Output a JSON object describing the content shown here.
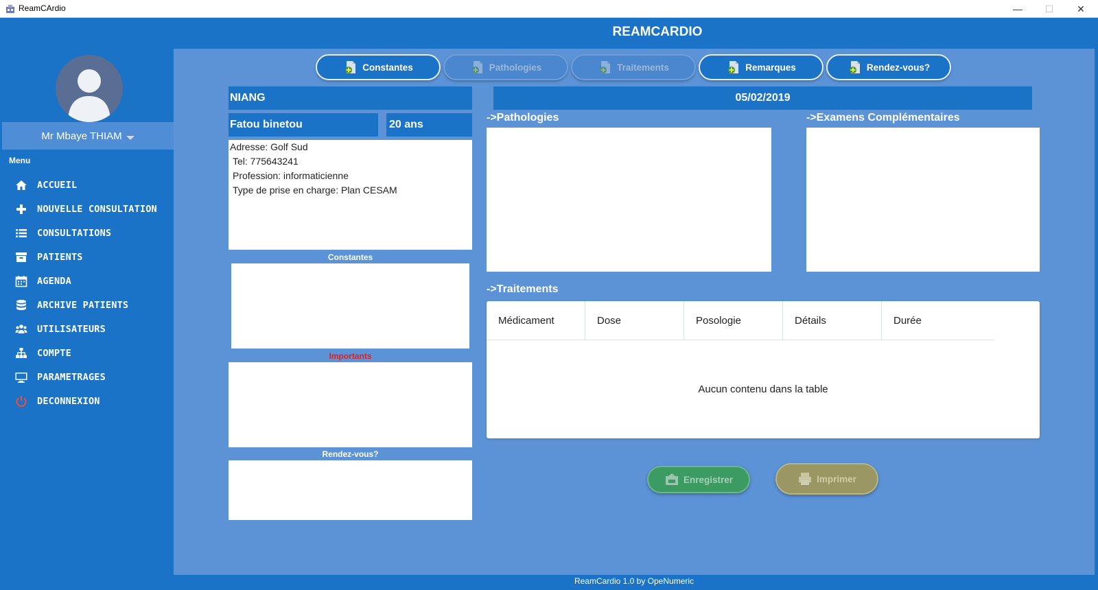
{
  "window": {
    "title": "ReamCArdio",
    "controls": {
      "minimize": "—",
      "maximize": "☐",
      "close": "✕"
    }
  },
  "header": {
    "title": "REAMCARDIO"
  },
  "sidebar": {
    "user_name": "Mr Mbaye THIAM",
    "menu_label": "Menu",
    "items": [
      {
        "label": "ACCUEIL",
        "icon": "home-icon"
      },
      {
        "label": "NOUVELLE CONSULTATION",
        "icon": "plus-icon"
      },
      {
        "label": "CONSULTATIONS",
        "icon": "list-icon"
      },
      {
        "label": "PATIENTS",
        "icon": "archive-box-icon"
      },
      {
        "label": "AGENDA",
        "icon": "calendar-icon"
      },
      {
        "label": "ARCHIVE PATIENTS",
        "icon": "database-icon"
      },
      {
        "label": "UTILISATEURS",
        "icon": "users-icon"
      },
      {
        "label": "COMPTE",
        "icon": "sitemap-icon"
      },
      {
        "label": "PARAMETRAGES",
        "icon": "monitor-icon"
      },
      {
        "label": "DECONNEXION",
        "icon": "power-icon"
      }
    ]
  },
  "tabs": [
    {
      "label": "Constantes",
      "enabled": true
    },
    {
      "label": "Pathologies",
      "enabled": false
    },
    {
      "label": "Traitements",
      "enabled": false
    },
    {
      "label": "Remarques",
      "enabled": true
    },
    {
      "label": "Rendez-vous?",
      "enabled": true
    }
  ],
  "patient": {
    "last_name": "NIANG",
    "first_name": "Fatou binetou",
    "age": "20 ans",
    "address": "Adresse: Golf Sud",
    "phone": "Tel: 775643241",
    "profession": "Profession: informaticienne",
    "coverage": "Type de prise en charge: Plan CESAM"
  },
  "left_sections": {
    "constantes": "Constantes",
    "importants": "Importants",
    "rendez_vous": "Rendez-vous?"
  },
  "consultation": {
    "date": "05/02/2019",
    "pathologies_label": "->Pathologies",
    "examens_label": "->Examens Complémentaires",
    "traitements_label": "->Traitements"
  },
  "table": {
    "columns": [
      "Médicament",
      "Dose",
      "Posologie",
      "Détails",
      "Durée"
    ],
    "empty_text": "Aucun contenu dans la table"
  },
  "actions": {
    "save": "Enregistrer",
    "print": "Imprimer"
  },
  "footer": {
    "text": "ReamCardio 1.0 by OpeNumeric"
  },
  "colors": {
    "primary": "#1a73c6",
    "content_bg": "#5b93d6",
    "important": "#e81e1e",
    "save_button": "#3c9a63",
    "print_button": "#9a9765"
  }
}
